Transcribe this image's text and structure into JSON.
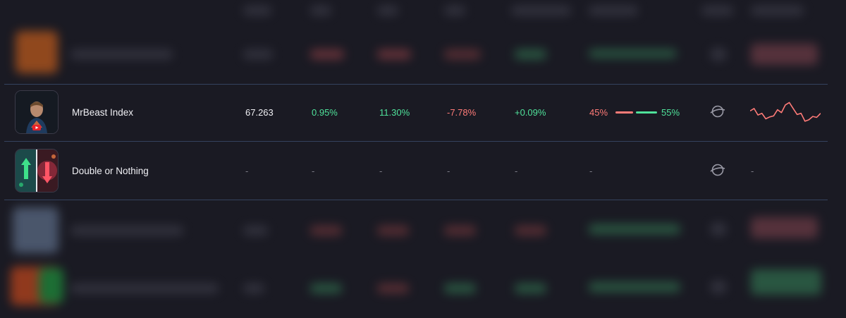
{
  "rows": [
    {
      "name": "MrBeast Index",
      "price": "67.263",
      "change_a": "0.95%",
      "change_b": "11.30%",
      "change_c": "-7.78%",
      "change_d": "+0.09%",
      "sentiment_left": "45%",
      "sentiment_right": "55%",
      "sparkline": [
        0.45,
        0.35,
        0.62,
        0.55,
        0.78,
        0.7,
        0.66,
        0.4,
        0.52,
        0.2,
        0.1,
        0.35,
        0.6,
        0.55,
        0.88,
        0.82,
        0.68,
        0.72,
        0.55
      ]
    },
    {
      "name": "Double or Nothing",
      "price": "-",
      "change_a": "-",
      "change_b": "-",
      "change_c": "-",
      "change_d": "-",
      "sentiment": "-",
      "sparkline_text": "-"
    }
  ],
  "icons": {
    "thumb_1": "person-video-thumbnail",
    "thumb_2": "double-arrows-thumbnail",
    "action": "globe-icon"
  },
  "colors": {
    "positive": "#4fe29a",
    "negative": "#ff7b78",
    "background": "#1a1a23"
  }
}
